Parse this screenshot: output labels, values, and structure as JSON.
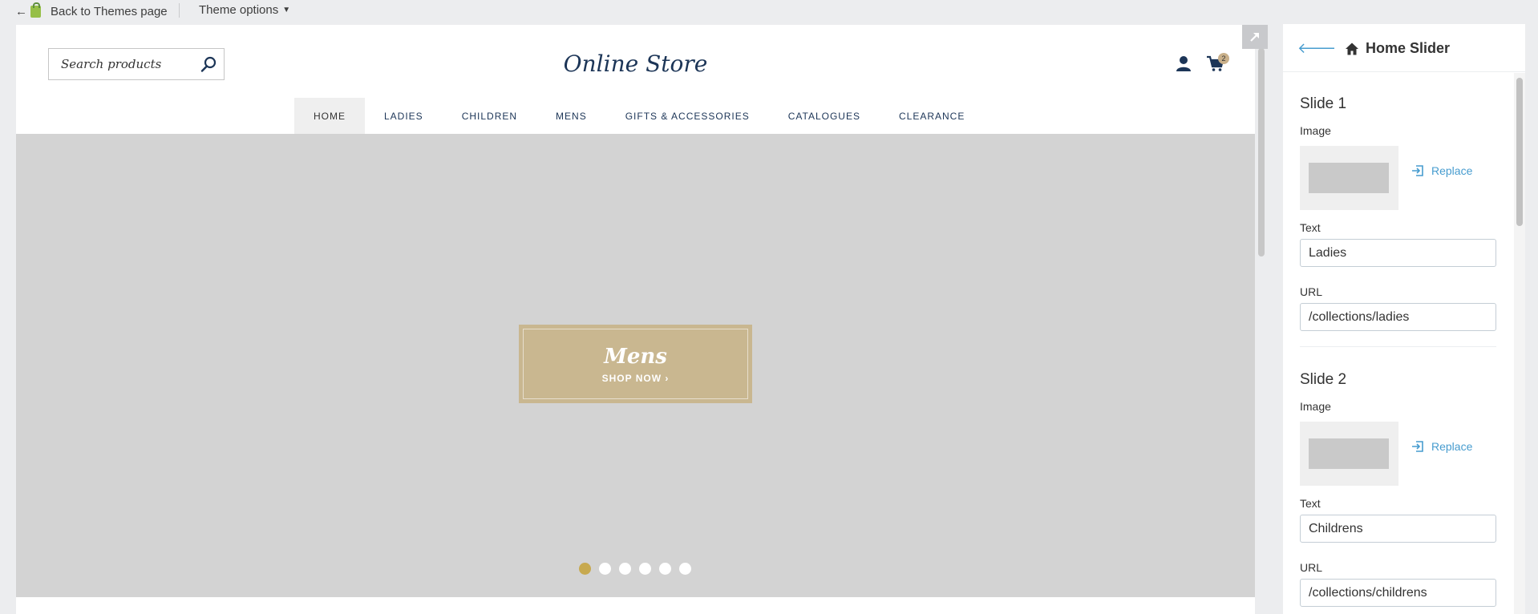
{
  "topbar": {
    "back_label": "Back to Themes page",
    "theme_options_label": "Theme options"
  },
  "store": {
    "search_placeholder": "Search products",
    "title": "Online Store",
    "cart_count": "2"
  },
  "nav": {
    "items": [
      {
        "label": "HOME",
        "active": true
      },
      {
        "label": "LADIES"
      },
      {
        "label": "CHILDREN"
      },
      {
        "label": "MENS"
      },
      {
        "label": "GIFTS & ACCESSORIES"
      },
      {
        "label": "CATALOGUES"
      },
      {
        "label": "CLEARANCE"
      }
    ]
  },
  "hero": {
    "title": "Mens",
    "cta": "SHOP NOW ›",
    "slide_count": 6,
    "active_slide": 1
  },
  "panel": {
    "title": "Home Slider",
    "slides": [
      {
        "heading": "Slide 1",
        "image_label": "Image",
        "replace_label": "Replace",
        "text_label": "Text",
        "text_value": "Ladies",
        "url_label": "URL",
        "url_value": "/collections/ladies"
      },
      {
        "heading": "Slide 2",
        "image_label": "Image",
        "replace_label": "Replace",
        "text_label": "Text",
        "text_value": "Childrens",
        "url_label": "URL",
        "url_value": "/collections/childrens"
      }
    ]
  },
  "colors": {
    "navy": "#1c3557",
    "gold": "#c9b790",
    "active_dot": "#c7a94f",
    "link_blue": "#479ccf",
    "hero_bg": "#d3d3d3"
  }
}
